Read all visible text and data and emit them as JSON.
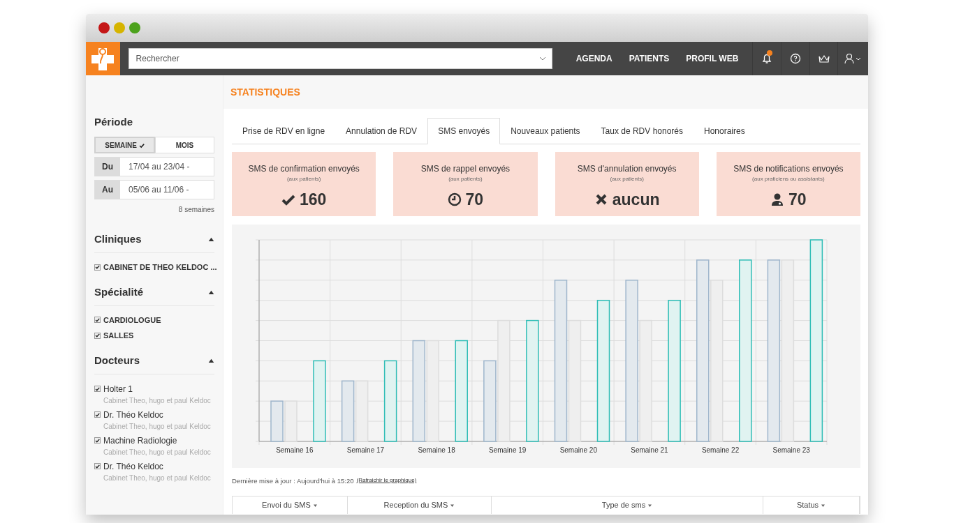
{
  "search": {
    "placeholder": "Rechercher"
  },
  "nav": [
    {
      "label": "AGENDA"
    },
    {
      "label": "PATIENTS"
    },
    {
      "label": "PROFIL WEB"
    }
  ],
  "notifications": {
    "unread": true
  },
  "page_title": "STATISTIQUES",
  "period": {
    "title": "Période",
    "toggle": [
      {
        "label": "SEMAINE",
        "selected": true
      },
      {
        "label": "MOIS",
        "selected": false
      }
    ],
    "dates": [
      {
        "label": "Du",
        "value": "17/04 au 23/04 -"
      },
      {
        "label": "Au",
        "value": "05/06 au 11/06 -"
      }
    ],
    "duration": "8 semaines"
  },
  "filters": [
    {
      "title": "Cliniques",
      "expanded": true,
      "items": [
        {
          "label": "CABINET DE THEO KELDOC ...",
          "checked": true
        }
      ]
    },
    {
      "title": "Spécialité",
      "expanded": true,
      "items": [
        {
          "label": "CARDIOLOGUE",
          "checked": true
        },
        {
          "label": "SALLES",
          "checked": true
        }
      ]
    },
    {
      "title": "Docteurs",
      "expanded": true,
      "items": [
        {
          "label": "Holter 1",
          "subtitle": "Cabinet Theo, hugo et paul Keldoc",
          "checked": true
        },
        {
          "label": "Dr. Théo Keldoc",
          "subtitle": "Cabinet Theo, hugo et paul Keldoc",
          "checked": true
        },
        {
          "label": "Machine Radiologie",
          "subtitle": "Cabinet Theo, hugo et paul Keldoc",
          "checked": true
        },
        {
          "label": "Dr. Théo Keldoc",
          "subtitle": "Cabinet Theo, hugo et paul Keldoc",
          "checked": true
        }
      ]
    }
  ],
  "tabs": [
    {
      "label": "Prise de RDV en ligne",
      "selected": false
    },
    {
      "label": "Annulation de RDV",
      "selected": false
    },
    {
      "label": "SMS envoyés",
      "selected": true
    },
    {
      "label": "Nouveaux patients",
      "selected": false
    },
    {
      "label": "Taux de RDV honorés",
      "selected": false
    },
    {
      "label": "Honoraires",
      "selected": false
    }
  ],
  "cards": [
    {
      "title": "SMS de confirmation envoyés",
      "subtitle": "(aux patients)",
      "value": "160",
      "kind": "check"
    },
    {
      "title": "SMS de rappel envoyés",
      "subtitle": "(aux patients)",
      "value": "70",
      "kind": "clock"
    },
    {
      "title": "SMS d'annulation envoyés",
      "subtitle": "(aux patients)",
      "value": "aucun",
      "kind": "cross"
    },
    {
      "title": "SMS de notifications envoyés",
      "subtitle": "(aux praticiens ou assistants)",
      "value": "70",
      "kind": "doctor"
    }
  ],
  "chart": {
    "x_labels": [
      "Semaine 16",
      "Semaine 17",
      "Semaine 18",
      "Semaine 19",
      "Semaine 20",
      "Semaine 21",
      "Semaine 22",
      "Semaine 23"
    ]
  },
  "update": {
    "text": "Dernière mise à jour : Aujourd'hui à 15:20",
    "link": "(Rafraichir le graphique)"
  },
  "table": {
    "columns": [
      "Envoi du SMS",
      "Reception du SMS",
      "Type de sms",
      "Status"
    ]
  }
}
